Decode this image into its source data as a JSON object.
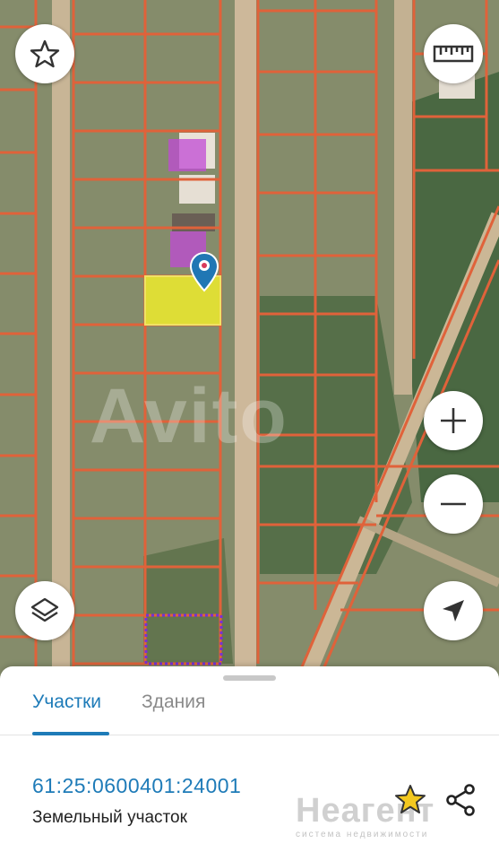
{
  "map": {
    "watermark": "Avito"
  },
  "controls": {
    "favorite_icon": "star-outline-icon",
    "ruler_icon": "ruler-icon",
    "zoom_in_icon": "plus-icon",
    "zoom_out_icon": "minus-icon",
    "layers_icon": "layers-icon",
    "location_icon": "navigation-arrow-icon",
    "marker_icon": "map-pin-icon"
  },
  "sheet": {
    "tabs": [
      {
        "label": "Участки",
        "active": true
      },
      {
        "label": "Здания",
        "active": false
      }
    ],
    "parcel": {
      "cadastral_number": "61:25:0600401:24001",
      "type": "Земельный участок"
    },
    "brand": {
      "name": "Неагент",
      "tagline": "система недвижимости"
    }
  },
  "colors": {
    "accent": "#1e7bb8",
    "parcel_border": "#e0623a",
    "selected_parcel": "#e8e631"
  }
}
